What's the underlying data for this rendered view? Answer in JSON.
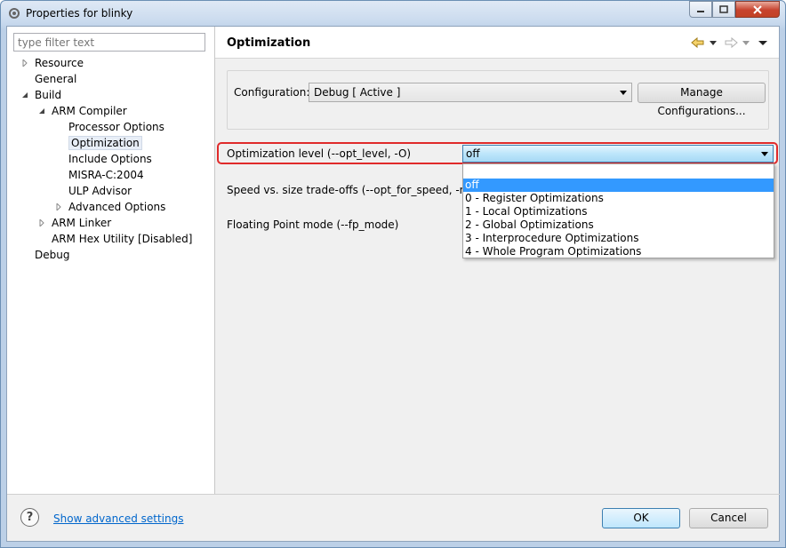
{
  "window": {
    "title": "Properties for blinky"
  },
  "filter": {
    "placeholder": "type filter text"
  },
  "tree": [
    {
      "label": "Resource",
      "twisty": "collapsed"
    },
    {
      "label": "General",
      "twisty": "none"
    },
    {
      "label": "Build",
      "twisty": "expanded"
    },
    {
      "label": "ARM Compiler",
      "twisty": "expanded"
    },
    {
      "label": "Processor Options",
      "twisty": "none"
    },
    {
      "label": "Optimization",
      "twisty": "none",
      "selected": true
    },
    {
      "label": "Include Options",
      "twisty": "none"
    },
    {
      "label": "MISRA-C:2004",
      "twisty": "none"
    },
    {
      "label": "ULP Advisor",
      "twisty": "none"
    },
    {
      "label": "Advanced Options",
      "twisty": "collapsed"
    },
    {
      "label": "ARM Linker",
      "twisty": "collapsed"
    },
    {
      "label": "ARM Hex Utility  [Disabled]",
      "twisty": "none"
    },
    {
      "label": "Debug",
      "twisty": "none"
    }
  ],
  "page": {
    "title": "Optimization"
  },
  "configuration": {
    "label": "Configuration:",
    "value": "Debug  [ Active ]",
    "manage_button": "Manage Configurations..."
  },
  "settings": {
    "opt_level_label": "Optimization level (--opt_level, -O)",
    "opt_level_value": "off",
    "speed_label": "Speed vs. size trade-offs (--opt_for_speed, -mf)",
    "fp_label": "Floating Point mode (--fp_mode)"
  },
  "dropdown_options": [
    "off",
    "0 - Register Optimizations",
    "1 - Local Optimizations",
    "2 - Global Optimizations",
    "3 - Interprocedure Optimizations",
    "4 - Whole Program Optimizations"
  ],
  "footer": {
    "help": "?",
    "advanced_link": "Show advanced settings",
    "ok": "OK",
    "cancel": "Cancel"
  },
  "colors": {
    "highlight": "#e02a2a",
    "selection": "#3399ff",
    "link": "#0066cc"
  }
}
